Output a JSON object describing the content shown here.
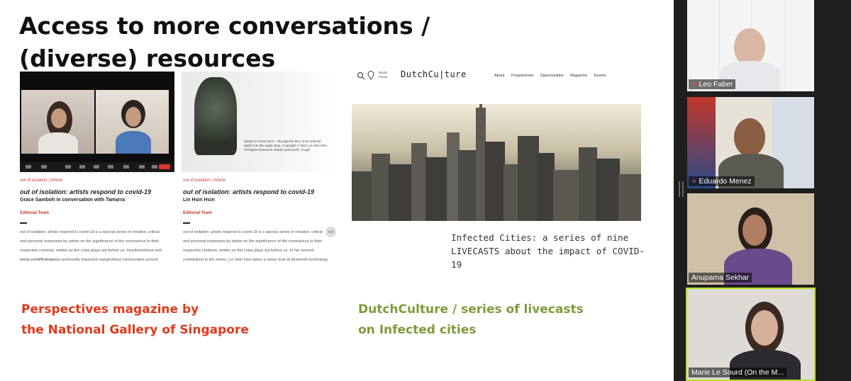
{
  "slide": {
    "title_line1": "Access to more conversations /",
    "title_line2": "(diverse) resources",
    "left_article_1": {
      "category": "out of isolation | Article",
      "title": "out of isolation: artists respond to covid-19",
      "subtitle": "Grace Samboh in conversation with Tamarra",
      "team": "Editorial Team",
      "body_lines": [
        "out of isolation: artists respond to covid-19 is a special series of creative, critical",
        "and personal responses by artists on the significance of the coronavirus to their",
        "respective contexts, written as the crisis plays out before us. #earthismhome and",
        "#disruption. Also, it has profoundly impacted marginalised communities around"
      ],
      "footer_url": "mocla.com/tt/findouters/"
    },
    "left_article_2": {
      "category": "out of isolation | Article",
      "title": "out of isolation: artists respond to covid-19",
      "subtitle": "Lin Hsin Hsin",
      "team": "Editorial Team",
      "image_caption": "Salute to Focal Genz —through the lens of an Arteroid addict into the Apple shop. Copyright © 2021 Lin Hsin Hsin. All Rights Reserved. Mobile (artroom®). Prog®",
      "body_lines": [
        "out of isolation: artists respond to covid-19 is a special series of creative, critical",
        "and personal responses by artists on the significance of the coronavirus to their",
        "respective contexts, written as the crisis plays out before us. In her second",
        "contribution to the series, Lin Hsin Hsin takes a closer look at bluetooth technology"
      ],
      "top_tag": "TOP"
    },
    "dutchculture": {
      "logo": "DutchCu|ture",
      "loc": "World Focus",
      "nav": [
        "About",
        "Programmes",
        "Opportunities",
        "Magazine",
        "Events"
      ],
      "caption": "Infected Cities: a series of nine LIVECASTS about the impact of COVID-19"
    },
    "caption_left_line1": "Perspectives magazine by",
    "caption_left_line2": "the National Gallery of Singapore",
    "caption_right_line1": "DutchCulture / series of livecasts",
    "caption_right_line2": "on Infected cities"
  },
  "participants": [
    {
      "name": "Leo Faber",
      "muted": true
    },
    {
      "name": "Eduardo Menez",
      "muted": true
    },
    {
      "name": "Anupama Sekhar",
      "muted": false
    },
    {
      "name": "Marie Le Sourd (On the M...",
      "muted": false,
      "active_speaker": true
    }
  ],
  "colors": {
    "caption_red": "#e03a1c",
    "caption_green": "#7f9a3a",
    "active_speaker_border": "#b6e01e",
    "muted_icon": "#e04a3a"
  }
}
